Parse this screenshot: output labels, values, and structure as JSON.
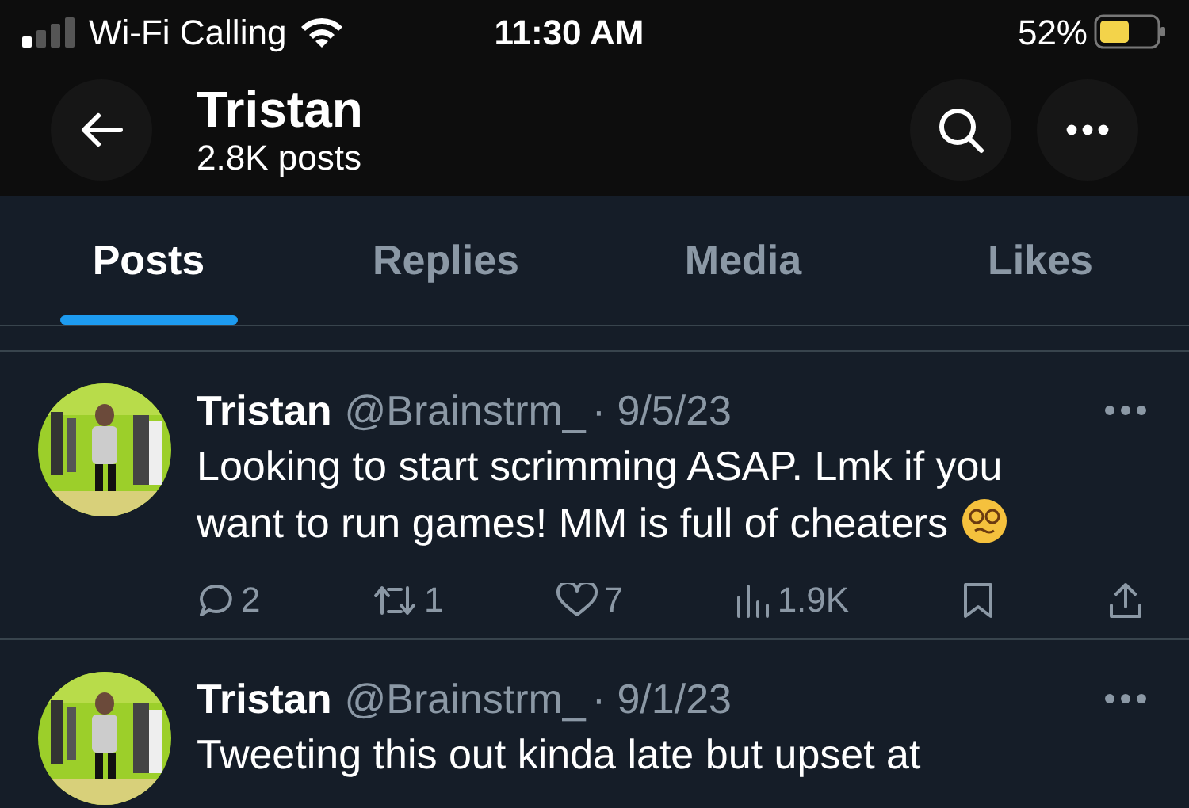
{
  "status_bar": {
    "carrier": "Wi-Fi Calling",
    "time": "11:30 AM",
    "battery": "52%"
  },
  "header": {
    "title": "Tristan",
    "subtitle": "2.8K posts"
  },
  "tabs": [
    {
      "label": "Posts",
      "selected": true
    },
    {
      "label": "Replies",
      "selected": false
    },
    {
      "label": "Media",
      "selected": false
    },
    {
      "label": "Likes",
      "selected": false
    }
  ],
  "posts": [
    {
      "name": "Tristan",
      "handle": "@Brainstrm_",
      "date": "· 9/5/23",
      "text": "Looking to start scrimming ASAP. Lmk if you want to run games! MM is full of cheaters",
      "replies": "2",
      "reposts": "1",
      "likes": "7",
      "views": "1.9K"
    },
    {
      "name": "Tristan",
      "handle": "@Brainstrm_",
      "date": "· 9/1/23",
      "text": "Tweeting this out kinda late but upset at"
    }
  ]
}
